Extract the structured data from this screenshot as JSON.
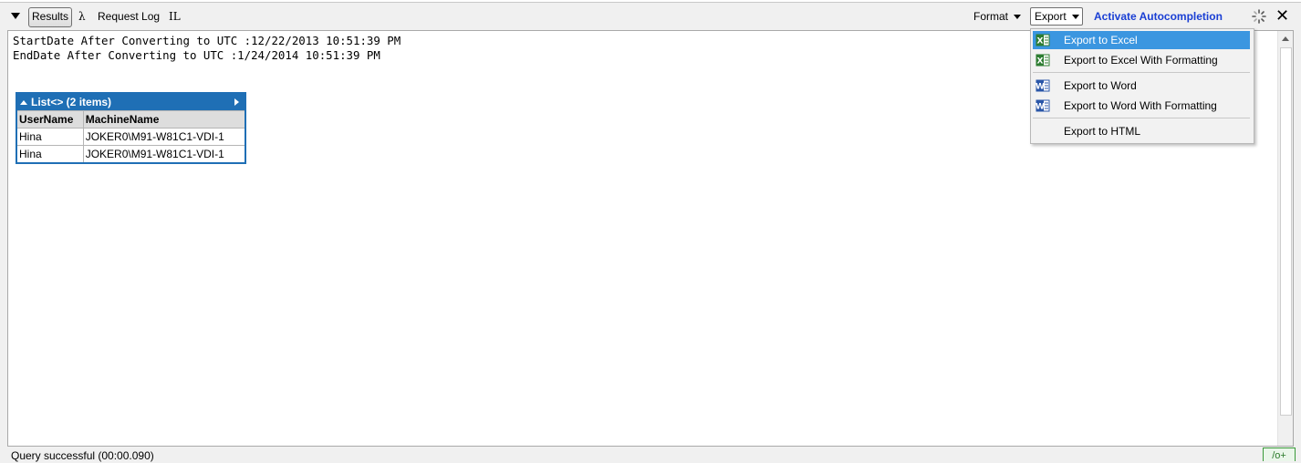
{
  "toolbar": {
    "results_label": "Results",
    "lambda_label": "λ",
    "request_log_label": "Request Log",
    "il_label": "IL",
    "format_label": "Format",
    "export_label": "Export",
    "activate_label": "Activate Autocompletion",
    "close_label": "✕"
  },
  "output": {
    "line1": "StartDate After Converting to UTC :12/22/2013 10:51:39 PM",
    "line2": "EndDate After Converting to UTC :1/24/2014 10:51:39 PM",
    "table": {
      "title": "List<> (2 items)",
      "columns": [
        "UserName",
        "MachineName"
      ],
      "rows": [
        [
          "Hina",
          "JOKER0\\M91-W81C1-VDI-1"
        ],
        [
          "Hina",
          "JOKER0\\M91-W81C1-VDI-1"
        ]
      ]
    }
  },
  "export_menu": {
    "items": [
      {
        "label": "Export to Excel",
        "icon": "excel-icon",
        "selected": true
      },
      {
        "label": "Export to Excel With Formatting",
        "icon": "excel-icon"
      },
      {
        "label": "Export to Word",
        "icon": "word-icon"
      },
      {
        "label": "Export to Word With Formatting",
        "icon": "word-icon"
      },
      {
        "label": "Export to HTML",
        "icon": ""
      }
    ]
  },
  "status": {
    "message": "Query successful  (00:00.090)",
    "lang_badge": "/o+"
  },
  "colors": {
    "accent": "#1f6fb5",
    "selection": "#3b96e0",
    "link": "#1a3fd4"
  }
}
